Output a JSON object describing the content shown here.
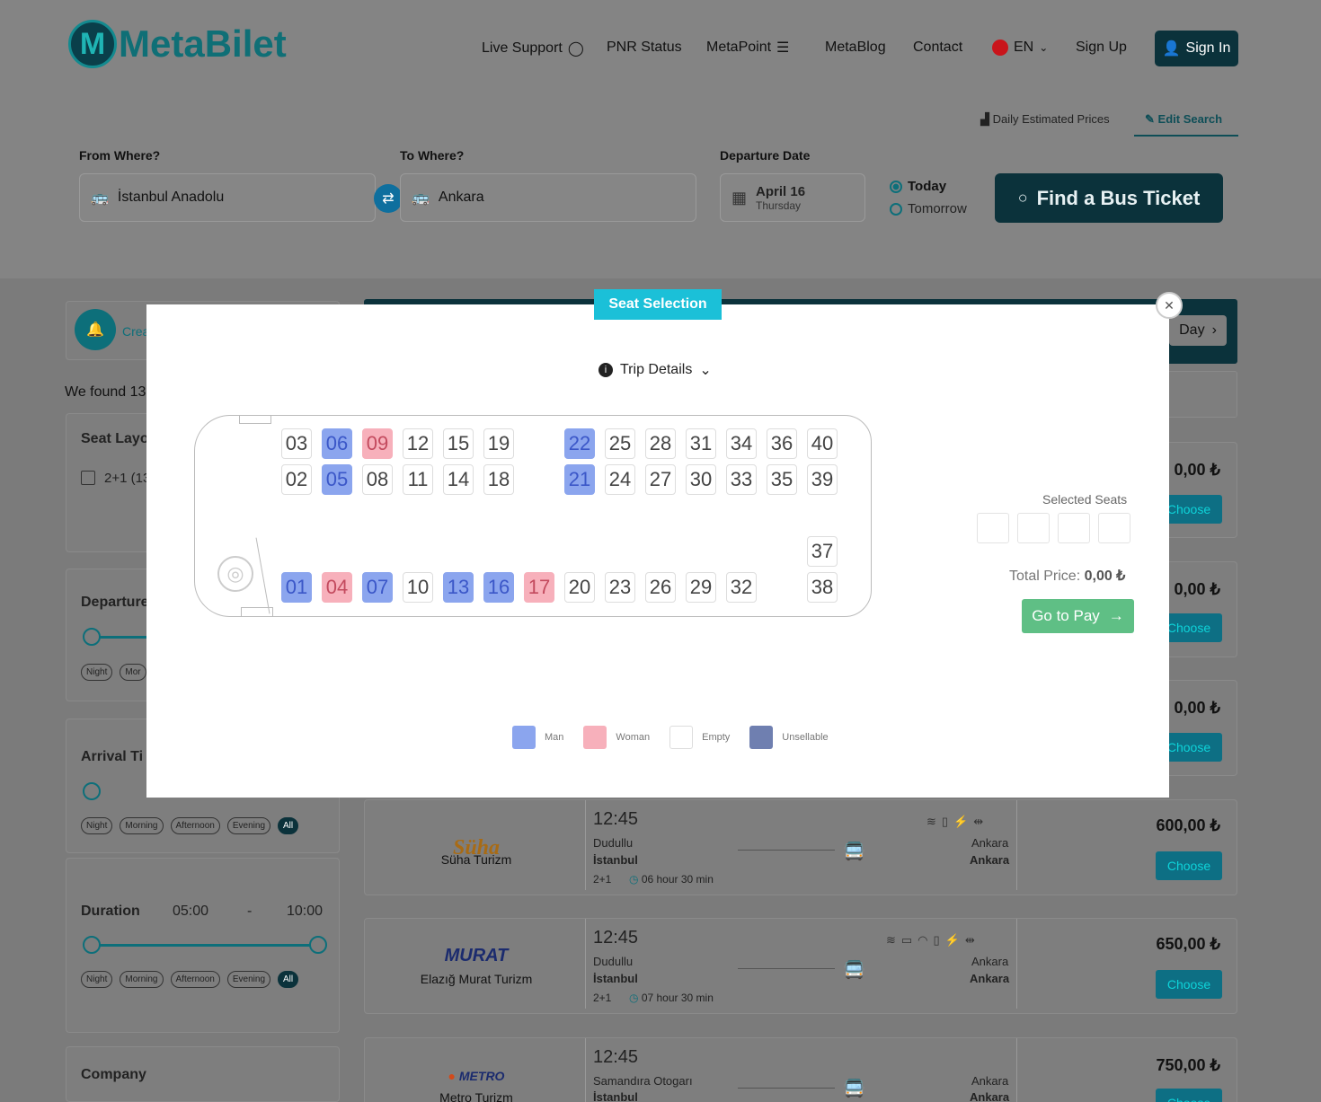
{
  "header": {
    "brand": "MetaBilet",
    "nav": {
      "live_support": "Live Support",
      "pnr_status": "PNR Status",
      "metapoint": "MetaPoint",
      "metablog": "MetaBlog",
      "contact": "Contact",
      "language": "EN",
      "sign_up": "Sign Up",
      "sign_in": "Sign In"
    }
  },
  "search": {
    "daily_prices": "Daily Estimated Prices",
    "edit_search": "Edit Search",
    "from_label": "From Where?",
    "from_value": "İstanbul Anadolu",
    "to_label": "To Where?",
    "to_value": "Ankara",
    "date_label": "Departure Date",
    "date_value": "April 16",
    "date_day": "Thursday",
    "today": "Today",
    "tomorrow": "Tomorrow",
    "find_button": "Find a Bus Ticket"
  },
  "sidebar": {
    "create_alert": "Crea",
    "found": "We found 13",
    "seat_layout_title": "Seat Layo",
    "seat_layout_option": "2+1 (13",
    "departure_title": "Departure",
    "arrival_title": "Arrival Ti",
    "duration_title": "Duration",
    "duration_min": "05:00",
    "duration_sep": "-",
    "duration_max": "10:00",
    "pills": [
      "Night",
      "Morning",
      "Afternoon",
      "Evening",
      "All"
    ],
    "departure_pills_partial": [
      "Night",
      "Mor"
    ],
    "company_title": "Company"
  },
  "results": {
    "next_day": "Day",
    "hidden_prices": [
      "0,00 ₺",
      "0,00 ₺",
      "0,00 ₺"
    ],
    "choose": "Choose",
    "trips": [
      {
        "company": "Süha Turizm",
        "logo_text": "Süha",
        "time": "12:45",
        "from_station": "Dudullu",
        "from_city": "İstanbul",
        "layout": "2+1",
        "duration": "06 hour 30 min",
        "to_station": "Ankara",
        "to_city": "Ankara",
        "price": "600,00 ₺"
      },
      {
        "company": "Elazığ Murat Turizm",
        "logo_text": "MURAT",
        "time": "12:45",
        "from_station": "Dudullu",
        "from_city": "İstanbul",
        "layout": "2+1",
        "duration": "07 hour 30 min",
        "to_station": "Ankara",
        "to_city": "Ankara",
        "price": "650,00 ₺"
      },
      {
        "company": "Metro Turizm",
        "logo_text": "METRO",
        "time": "12:45",
        "from_station": "Samandıra Otogarı",
        "from_city": "İstanbul",
        "to_station": "Ankara",
        "to_city": "Ankara",
        "price": "750,00 ₺"
      }
    ]
  },
  "modal": {
    "tab": "Seat Selection",
    "trip_details": "Trip Details",
    "selected_seats": "Selected Seats",
    "total_price_label": "Total Price:",
    "total_price_value": "0,00 ₺",
    "go_to_pay": "Go to Pay",
    "legend": {
      "man": "Man",
      "woman": "Woman",
      "empty": "Empty",
      "unsellable": "Unsellable"
    },
    "seats": {
      "row_top": [
        [
          "03",
          "empty"
        ],
        [
          "06",
          "man"
        ],
        [
          "09",
          "woman"
        ],
        [
          "12",
          "empty"
        ],
        [
          "15",
          "empty"
        ],
        [
          "19",
          "empty"
        ],
        [
          "22",
          "man"
        ],
        [
          "25",
          "empty"
        ],
        [
          "28",
          "empty"
        ],
        [
          "31",
          "empty"
        ],
        [
          "34",
          "empty"
        ],
        [
          "36",
          "empty"
        ],
        [
          "40",
          "empty"
        ]
      ],
      "row_mid": [
        [
          "02",
          "empty"
        ],
        [
          "05",
          "man"
        ],
        [
          "08",
          "empty"
        ],
        [
          "11",
          "empty"
        ],
        [
          "14",
          "empty"
        ],
        [
          "18",
          "empty"
        ],
        [
          "21",
          "man"
        ],
        [
          "24",
          "empty"
        ],
        [
          "27",
          "empty"
        ],
        [
          "30",
          "empty"
        ],
        [
          "33",
          "empty"
        ],
        [
          "35",
          "empty"
        ],
        [
          "39",
          "empty"
        ]
      ],
      "row_single": [
        [
          "37",
          "empty"
        ]
      ],
      "row_bottom": [
        [
          "01",
          "man"
        ],
        [
          "04",
          "woman"
        ],
        [
          "07",
          "man"
        ],
        [
          "10",
          "empty"
        ],
        [
          "13",
          "man"
        ],
        [
          "16",
          "man"
        ],
        [
          "17",
          "woman"
        ],
        [
          "20",
          "empty"
        ],
        [
          "23",
          "empty"
        ],
        [
          "26",
          "empty"
        ],
        [
          "29",
          "empty"
        ],
        [
          "32",
          "empty"
        ],
        [
          "38",
          "empty"
        ]
      ]
    },
    "colors": {
      "man": "#8ba5ee",
      "woman": "#f7b0bb",
      "empty": "#ffffff",
      "unsellable": "#6f7fb0",
      "tab": "#1bc0d8",
      "pay": "#5fbf85"
    }
  }
}
